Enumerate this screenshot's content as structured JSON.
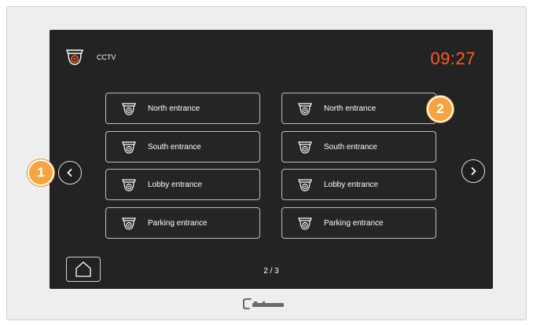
{
  "header": {
    "app_title": "CCTV",
    "clock": "09:27"
  },
  "cameras": {
    "left": [
      {
        "label": "North entrance"
      },
      {
        "label": "South entrance"
      },
      {
        "label": "Lobby entrance"
      },
      {
        "label": "Parking entrance"
      }
    ],
    "right": [
      {
        "label": "North entrance"
      },
      {
        "label": "South entrance"
      },
      {
        "label": "Lobby entrance"
      },
      {
        "label": "Parking entrance"
      }
    ]
  },
  "pagination": {
    "indicator": "2 / 3"
  },
  "callouts": {
    "first": "1",
    "second": "2"
  },
  "icons": {
    "app": "cctv-camera-icon",
    "camera": "dome-camera-icon",
    "prev": "chevron-left-icon",
    "next": "chevron-right-icon",
    "home": "home-icon"
  },
  "colors": {
    "screen_bg": "#232323",
    "clock": "#ff5a26",
    "callout": "#f6a441",
    "button_border": "#bdbdbd"
  }
}
